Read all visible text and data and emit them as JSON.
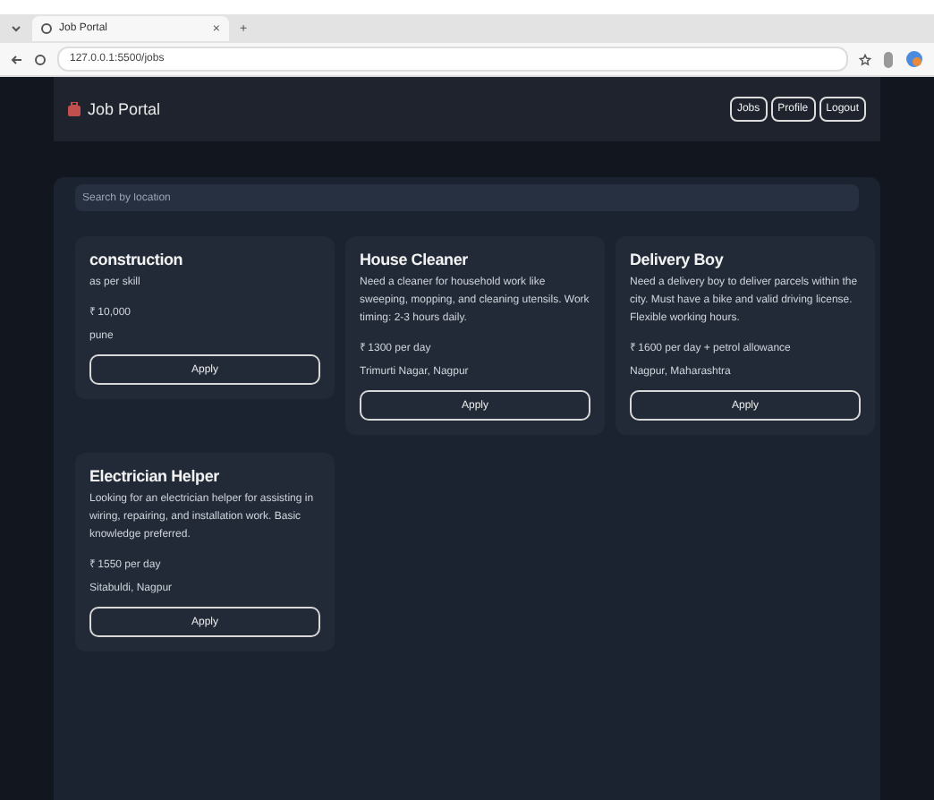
{
  "browser": {
    "tab_title": "Job Portal",
    "tab_close": "×",
    "new_tab": "+",
    "url": "127.0.0.1:5500/jobs"
  },
  "navbar": {
    "brand": "Job Portal",
    "links": [
      "Jobs",
      "Profile",
      "Logout"
    ]
  },
  "search": {
    "placeholder": "Search by location"
  },
  "jobs": [
    {
      "title": "construction",
      "description": "as per skill",
      "pay": "₹ 10,000",
      "location": "pune",
      "button": "Apply"
    },
    {
      "title": "House Cleaner",
      "description": "Need a cleaner for household work like sweeping, mopping, and cleaning utensils. Work timing: 2-3 hours daily.",
      "pay": "₹ 1300 per day",
      "location": "Trimurti Nagar, Nagpur",
      "button": "Apply"
    },
    {
      "title": "Delivery Boy",
      "description": "Need a delivery boy to deliver parcels within the city. Must have a bike and valid driving license. Flexible working hours.",
      "pay": "₹ 1600 per day + petrol allowance",
      "location": "Nagpur, Maharashtra",
      "button": "Apply"
    },
    {
      "title": "Electrician Helper",
      "description": "Looking for an electrician helper for assisting in wiring, repairing, and installation work. Basic knowledge preferred.",
      "pay": "₹ 1550 per day",
      "location": "Sitabuldi, Nagpur",
      "button": "Apply"
    }
  ]
}
